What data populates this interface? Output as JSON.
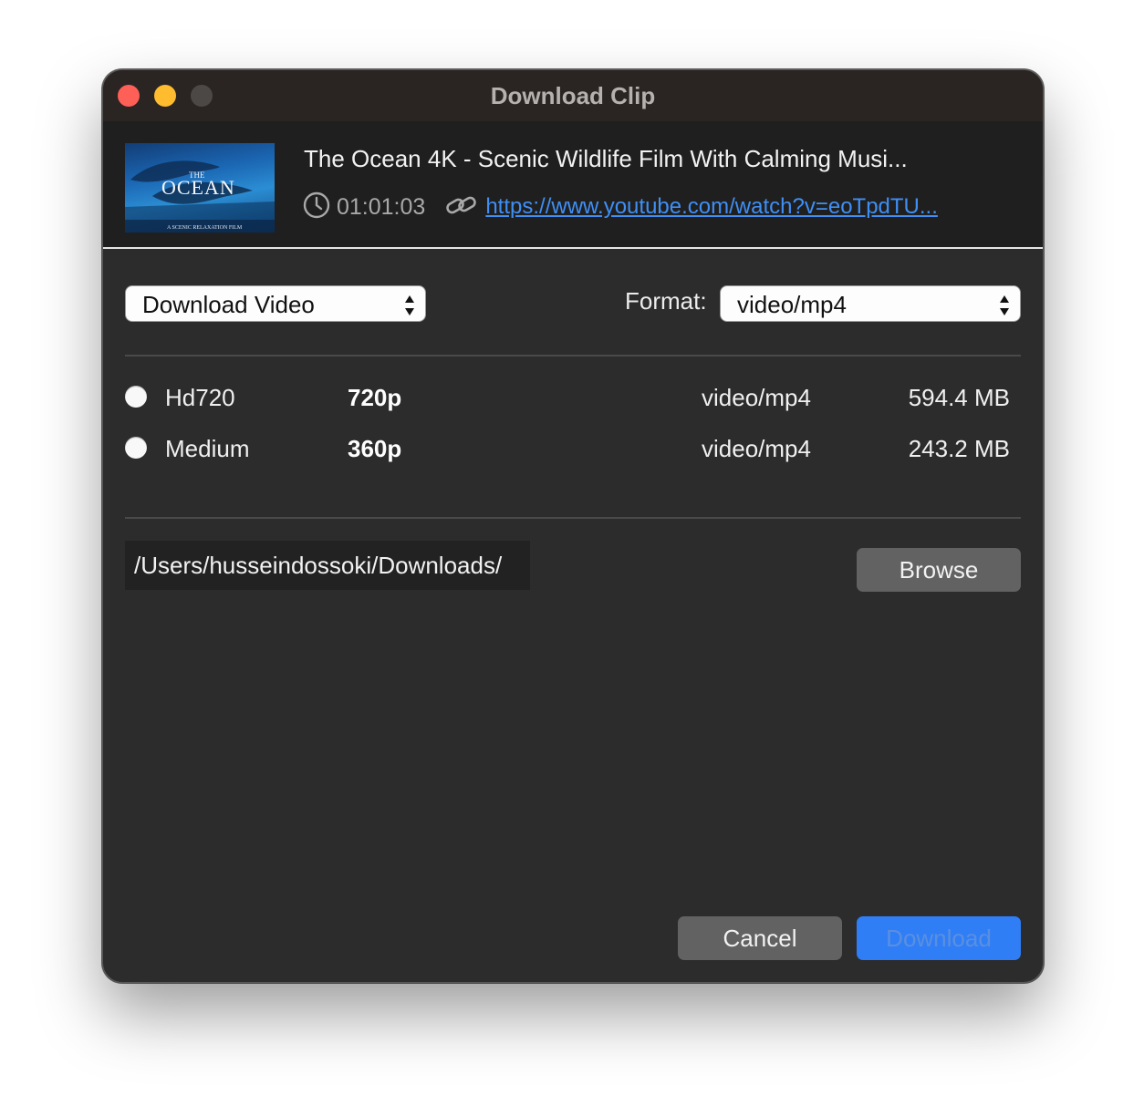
{
  "window": {
    "title": "Download Clip"
  },
  "video": {
    "title": "The Ocean 4K - Scenic Wildlife Film With Calming Musi...",
    "duration": "01:01:03",
    "url": "https://www.youtube.com/watch?v=eoTpdTU...",
    "thumbnail": {
      "small_text": "THE",
      "big_text": "OCEAN",
      "caption": "A SCENIC RELAXATION FILM"
    }
  },
  "controls": {
    "download_type": "Download Video",
    "format_label": "Format:",
    "format_value": "video/mp4"
  },
  "streams": [
    {
      "name": "Hd720",
      "resolution": "720p",
      "mime": "video/mp4",
      "size": "594.4 MB",
      "selected": false
    },
    {
      "name": "Medium",
      "resolution": "360p",
      "mime": "video/mp4",
      "size": "243.2 MB",
      "selected": false
    }
  ],
  "destination": {
    "path": "/Users/husseindossoki/Downloads/",
    "browse_label": "Browse"
  },
  "footer": {
    "cancel_label": "Cancel",
    "download_label": "Download"
  },
  "colors": {
    "accent": "#2f7ef6",
    "link": "#3f8ff5",
    "window_bg": "#2c2c2c",
    "close": "#fe5f57",
    "minimize": "#febc2e"
  },
  "icons": [
    "clock-icon",
    "link-icon",
    "chevron-up-down-icon"
  ]
}
